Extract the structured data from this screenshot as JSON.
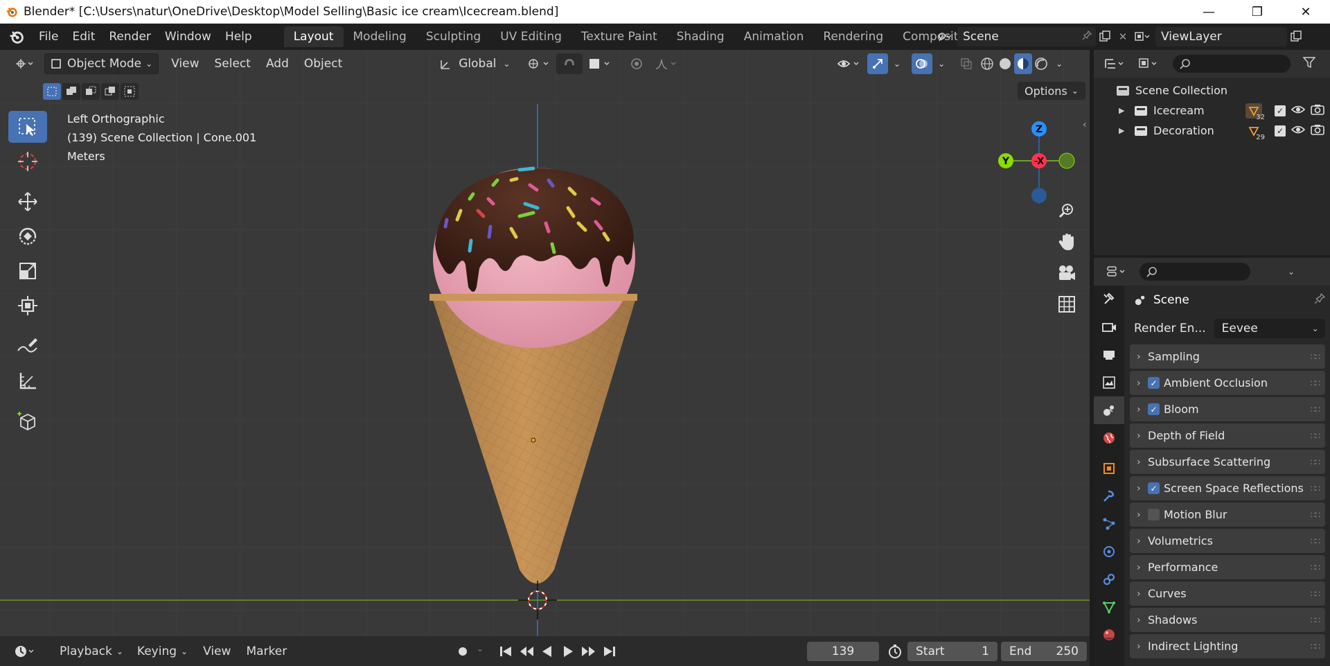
{
  "window": {
    "title": "Blender* [C:\\Users\\natur\\OneDrive\\Desktop\\Model Selling\\Basic ice cream\\Icecream.blend]",
    "minimize": "—",
    "maximize": "❐",
    "close": "✕"
  },
  "menu": [
    "File",
    "Edit",
    "Render",
    "Window",
    "Help"
  ],
  "workspaces": [
    "Layout",
    "Modeling",
    "Sculpting",
    "UV Editing",
    "Texture Paint",
    "Shading",
    "Animation",
    "Rendering",
    "Compositin"
  ],
  "active_workspace": "Layout",
  "scene_selector": "Scene",
  "viewlayer_selector": "ViewLayer",
  "viewport_header": {
    "mode": "Object Mode",
    "view": "View",
    "select": "Select",
    "add": "Add",
    "object": "Object",
    "orientation": "Global",
    "options": "Options"
  },
  "viewport_overlay": {
    "view_name": "Left Orthographic",
    "collection_info": "(139) Scene Collection | Cone.001",
    "units": "Meters"
  },
  "gizmo": {
    "z": "Z",
    "y": "Y",
    "neg_x": "-X"
  },
  "timeline": {
    "playback": "Playback",
    "keying": "Keying",
    "view": "View",
    "marker": "Marker",
    "current_frame": "139",
    "start_label": "Start",
    "start": "1",
    "end_label": "End",
    "end": "250"
  },
  "outliner": {
    "root": "Scene Collection",
    "collections": [
      {
        "name": "Icecream",
        "count": "32"
      },
      {
        "name": "Decoration",
        "count": "29"
      }
    ]
  },
  "properties": {
    "context": "Scene",
    "render_engine_label": "Render En...",
    "render_engine": "Eevee",
    "panels": [
      {
        "label": "Sampling",
        "checkbox": "none"
      },
      {
        "label": "Ambient Occlusion",
        "checkbox": "on"
      },
      {
        "label": "Bloom",
        "checkbox": "on"
      },
      {
        "label": "Depth of Field",
        "checkbox": "none"
      },
      {
        "label": "Subsurface Scattering",
        "checkbox": "none"
      },
      {
        "label": "Screen Space Reflections",
        "checkbox": "on"
      },
      {
        "label": "Motion Blur",
        "checkbox": "off"
      },
      {
        "label": "Volumetrics",
        "checkbox": "none"
      },
      {
        "label": "Performance",
        "checkbox": "none"
      },
      {
        "label": "Curves",
        "checkbox": "none"
      },
      {
        "label": "Shadows",
        "checkbox": "none"
      },
      {
        "label": "Indirect Lighting",
        "checkbox": "none"
      }
    ]
  },
  "colors": {
    "accent": "#4772b3",
    "viewport_bg": "#393939",
    "x_axis": "#ff3352",
    "y_axis": "#8bdc00",
    "z_axis": "#2890ff"
  }
}
